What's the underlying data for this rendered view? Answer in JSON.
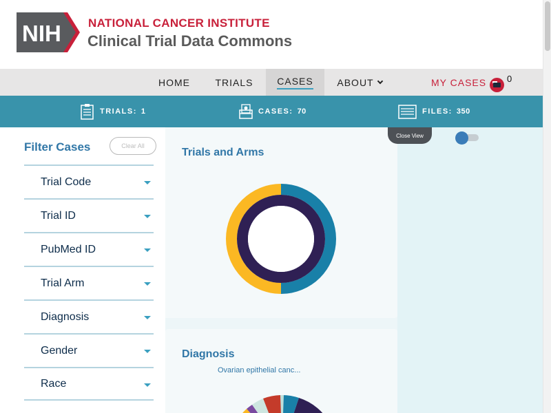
{
  "header": {
    "logo_text": "NIH",
    "org_name": "NATIONAL CANCER INSTITUTE",
    "app_name": "Clinical Trial Data Commons"
  },
  "nav": {
    "items": [
      {
        "label": "HOME"
      },
      {
        "label": "TRIALS"
      },
      {
        "label": "CASES",
        "active": true
      },
      {
        "label": "ABOUT"
      }
    ],
    "my_cases_label": "MY CASES",
    "cart_count": "0"
  },
  "stats": {
    "trials_label": "TRIALS:",
    "trials_value": "1",
    "cases_label": "CASES:",
    "cases_value": "70",
    "files_label": "FILES:",
    "files_value": "350"
  },
  "filters": {
    "title": "Filter Cases",
    "clear_label": "Clear All",
    "facets": [
      {
        "label": "Trial Code"
      },
      {
        "label": "Trial ID"
      },
      {
        "label": "PubMed ID"
      },
      {
        "label": "Trial Arm"
      },
      {
        "label": "Diagnosis"
      },
      {
        "label": "Gender"
      },
      {
        "label": "Race"
      }
    ]
  },
  "widgets": {
    "close_view_label": "Close View",
    "trials_and_arms_title": "Trials and Arms",
    "diagnosis_title": "Diagnosis",
    "diagnosis_hover_label": "Ovarian epithelial canc..."
  },
  "colors": {
    "brand_red": "#c8203a",
    "stats_bar": "#3993ab",
    "title_blue": "#3177a7",
    "donut_yellow": "#fbb823",
    "donut_teal": "#1980a8",
    "donut_navy": "#2f2054"
  },
  "chart_data": [
    {
      "type": "pie",
      "title": "Trials and Arms",
      "outer_ring": {
        "colors": [
          "#1980a8",
          "#fbb823"
        ],
        "values": [
          50,
          50
        ]
      },
      "inner_ring": {
        "colors": [
          "#2f2054"
        ],
        "values": [
          100
        ]
      }
    },
    {
      "type": "pie",
      "title": "Diagnosis",
      "visible_label": "Ovarian epithelial canc..."
    }
  ]
}
